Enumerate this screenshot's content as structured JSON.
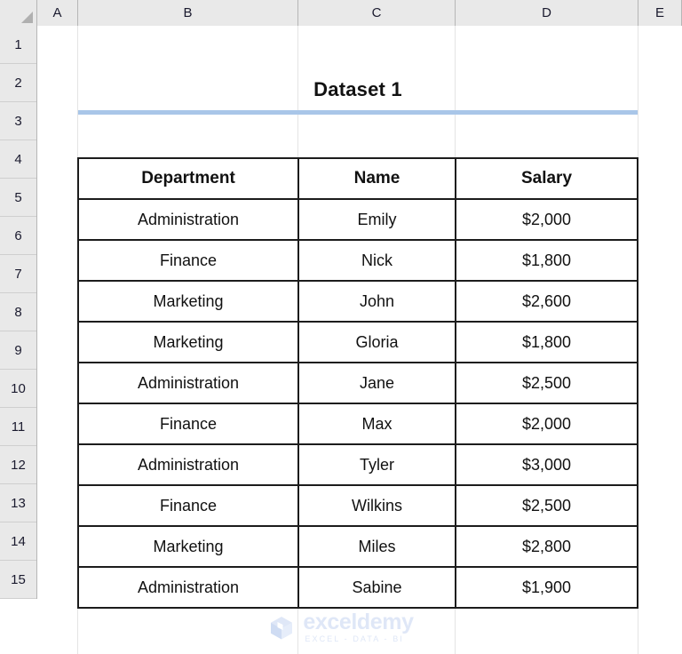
{
  "app": {
    "type": "spreadsheet",
    "column_headers": [
      "A",
      "B",
      "C",
      "D",
      "E"
    ],
    "row_headers": [
      "1",
      "2",
      "3",
      "4",
      "5",
      "6",
      "7",
      "8",
      "9",
      "10",
      "11",
      "12",
      "13",
      "14",
      "15"
    ]
  },
  "title": {
    "text": "Dataset 1",
    "rule_color": "#A9C6E8"
  },
  "table": {
    "headers": [
      {
        "label": "Department",
        "color": "#FFC000"
      },
      {
        "label": "Name",
        "color": "#92D050"
      },
      {
        "label": "Salary",
        "color": "#BDD7EE"
      }
    ],
    "rows": [
      {
        "department": "Administration",
        "name": "Emily",
        "salary": "$2,000"
      },
      {
        "department": "Finance",
        "name": "Nick",
        "salary": "$1,800"
      },
      {
        "department": "Marketing",
        "name": "John",
        "salary": "$2,600"
      },
      {
        "department": "Marketing",
        "name": "Gloria",
        "salary": "$1,800"
      },
      {
        "department": "Administration",
        "name": "Jane",
        "salary": "$2,500"
      },
      {
        "department": "Finance",
        "name": "Max",
        "salary": "$2,000"
      },
      {
        "department": "Administration",
        "name": "Tyler",
        "salary": "$3,000"
      },
      {
        "department": "Finance",
        "name": "Wilkins",
        "salary": "$2,500"
      },
      {
        "department": "Marketing",
        "name": "Miles",
        "salary": "$2,800"
      },
      {
        "department": "Administration",
        "name": "Sabine",
        "salary": "$1,900"
      }
    ]
  },
  "watermark": {
    "name": "exceldemy",
    "tagline": "EXCEL - DATA - BI",
    "color": "#DFE7F7",
    "icon": "cube-logo-icon"
  }
}
